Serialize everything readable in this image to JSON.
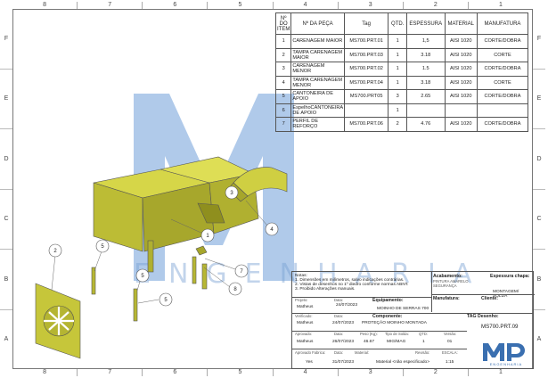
{
  "zones": {
    "columns": [
      "8",
      "7",
      "6",
      "5",
      "4",
      "3",
      "2",
      "1"
    ],
    "rows": [
      "F",
      "E",
      "D",
      "C",
      "B",
      "A"
    ]
  },
  "bom": {
    "headers": [
      "Nº DO ITEM",
      "Nº DA PEÇA",
      "Tag",
      "QTD.",
      "ESPESSURA",
      "MATERIAL",
      "MANUFATURA"
    ],
    "rows": [
      [
        "1",
        "CARENAGEM MAIOR",
        "MS700.PRT.01",
        "1",
        "1,5",
        "AISI 1020",
        "CORTE/DOBRA"
      ],
      [
        "2",
        "TAMPA CARENAGEM MAIOR",
        "MS700.PRT.03",
        "1",
        "3.18",
        "AISI 1020",
        "CORTE"
      ],
      [
        "3",
        "CARENAGEM MENOR",
        "MS700.PRT.02",
        "1",
        "1.5",
        "AISI 1020",
        "CORTE/DOBRA"
      ],
      [
        "4",
        "TAMPA CARENAGEM MENOR",
        "MS700.PRT.04",
        "1",
        "3.18",
        "AISI 1020",
        "CORTE"
      ],
      [
        "5",
        "CANTONEIRA DE APOIO",
        "MS700.PRT05",
        "3",
        "2.65",
        "AISI 1020",
        "CORTE/DOBRA"
      ],
      [
        "6",
        "EspelhoCANTONEIRA DE APOIO",
        "",
        "1",
        "",
        "",
        ""
      ],
      [
        "7",
        "PERFIL DE REFORÇO",
        "MS700.PRT.06",
        "2",
        "4.76",
        "AISI 1020",
        "CORTE/DOBRA"
      ]
    ]
  },
  "balloons": [
    "1",
    "2",
    "3",
    "4",
    "5",
    "5",
    "5",
    "7",
    "8"
  ],
  "watermark": {
    "text": "ENGENHARIA"
  },
  "title_block": {
    "notes": [
      "Notas:",
      "1. Dimensões em milímetros, salvo indicações contrárias.",
      "2. Vistas de desenhos no 1º diedro conforme normas ABNT.",
      "3. Proibido Alterações manuais."
    ],
    "acabamento_label": "Acabamento:",
    "acabamento_value": "PINTURA AMARELO SEGURANÇA",
    "espessura_label": "Espessura chapa:",
    "manufatura_label": "Manufatura:",
    "manufatura_value": "MONTAGEM/ SOLDA",
    "cliente_label": "Cliente:",
    "projeto_label": "Projeto:",
    "projeto_value": "Matheus",
    "data_label": "Data:",
    "projeto_data": "24/07/2023",
    "equipamento_label": "Equipamento:",
    "equipamento_value": "MOINHO DE SERRAS 700",
    "verificado_label": "Verificado:",
    "verificado_value": "Matheus",
    "verificado_data": "24/07/2023",
    "componente_label": "Componente:",
    "componente_value": "PROTEÇÃO MOINHO MONTADA",
    "tag_label": "TAG Desenho:",
    "tag_value": "MS700.PRT.09",
    "aprovado_label": "Aprovado:",
    "aprovado_value": "Matheus",
    "aprovado_data": "26/07/2023",
    "peso_label": "Peso (Kg):",
    "peso_value": "46.67",
    "tipo_label": "Tipo de Solda:",
    "tipo_value": "MIG/MAG",
    "qtd_label": "QTD:",
    "qtd_value": "1",
    "versao_label": "Versão:",
    "versao_value": "01",
    "aprovado_fab_label": "Aprovado Fabrica:",
    "aprovado_fab_value": "Yes",
    "fab_data": "31/07/2023",
    "material_label": "Material:",
    "material_value": "Material <não especificado>",
    "revisao_label": "Revisão:",
    "escala_label": "ESCALA:",
    "escala_value": "1:15"
  },
  "logo": {
    "text": "ENGENHARIA"
  },
  "colors": {
    "part": "#c9c93a",
    "part_dark": "#8f8f1e",
    "watermark": "#6f9fd8"
  }
}
